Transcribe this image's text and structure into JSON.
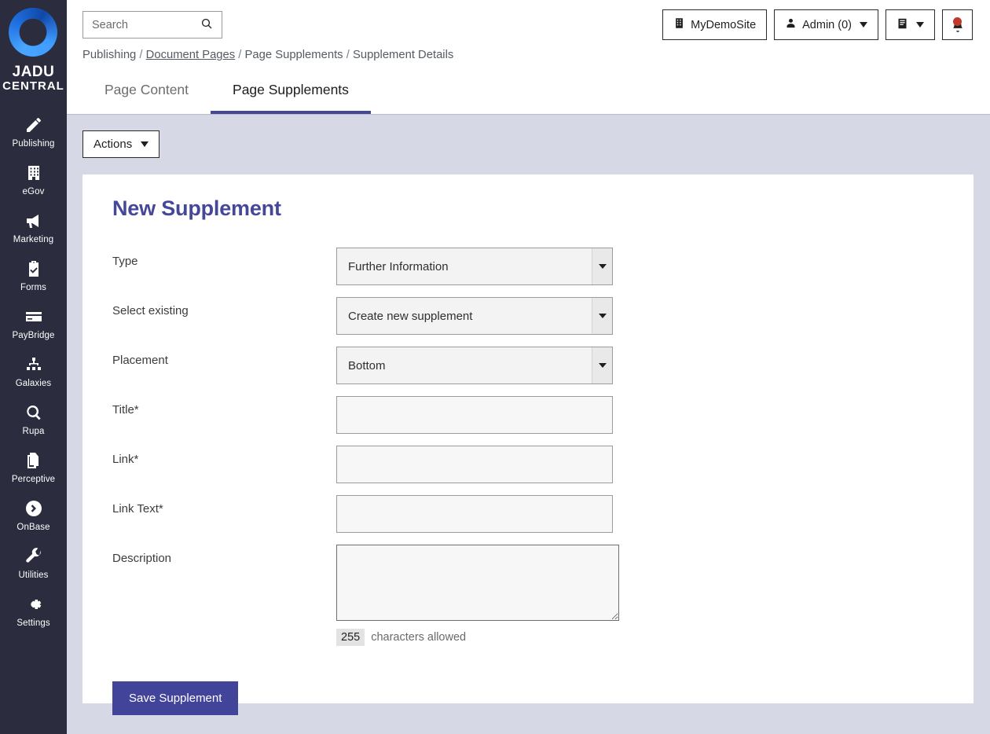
{
  "brand": {
    "logo_icon": "jadu-ring-logo",
    "line1": "JADU",
    "line2": "CENTRAL"
  },
  "sidebar": {
    "items": [
      {
        "label": "Publishing",
        "icon": "pencil-icon"
      },
      {
        "label": "eGov",
        "icon": "building-icon"
      },
      {
        "label": "Marketing",
        "icon": "megaphone-icon"
      },
      {
        "label": "Forms",
        "icon": "clipboard-check-icon"
      },
      {
        "label": "PayBridge",
        "icon": "credit-card-icon"
      },
      {
        "label": "Galaxies",
        "icon": "sitemap-icon"
      },
      {
        "label": "Rupa",
        "icon": "magnifier-icon"
      },
      {
        "label": "Perceptive",
        "icon": "copy-documents-icon"
      },
      {
        "label": "OnBase",
        "icon": "circle-chevron-right-icon"
      },
      {
        "label": "Utilities",
        "icon": "wrench-icon"
      },
      {
        "label": "Settings",
        "icon": "gear-icon"
      }
    ]
  },
  "header": {
    "search": {
      "value": "",
      "placeholder": "Search",
      "icon": "search-icon"
    },
    "site_button": {
      "label": "MyDemoSite",
      "icon": "building-icon"
    },
    "admin_button": {
      "label": "Admin (0)",
      "icon": "user-icon",
      "caret": "chevron-down-icon"
    },
    "docs_button": {
      "label": "",
      "icon": "book-icon",
      "caret": "chevron-down-icon"
    },
    "notifications_button": {
      "label": "",
      "icon": "bell-icon",
      "has_alert": true
    }
  },
  "breadcrumb": {
    "items": [
      "Publishing",
      "Document Pages",
      "Page Supplements",
      "Supplement Details"
    ],
    "linked_index": 1,
    "separator": "/"
  },
  "tabs": [
    {
      "label": "Page Content",
      "active": false
    },
    {
      "label": "Page Supplements",
      "active": true
    }
  ],
  "toolbar": {
    "actions_label": "Actions",
    "actions_caret": "chevron-down-icon"
  },
  "form": {
    "title": "New Supplement",
    "fields": [
      {
        "label": "Type",
        "type": "select",
        "value": "Further Information"
      },
      {
        "label": "Select existing",
        "type": "select",
        "value": "Create new supplement"
      },
      {
        "label": "Placement",
        "type": "select",
        "value": "Bottom"
      },
      {
        "label": "Title*",
        "type": "text",
        "value": "",
        "placeholder": ""
      },
      {
        "label": "Link*",
        "type": "text",
        "value": "",
        "placeholder": ""
      },
      {
        "label": "Link Text*",
        "type": "text",
        "value": "",
        "placeholder": ""
      },
      {
        "label": "Description",
        "type": "textarea",
        "value": "",
        "placeholder": ""
      }
    ],
    "char_limit": "255",
    "char_limit_text": "characters allowed",
    "save_label": "Save Supplement"
  },
  "colors": {
    "brand_indigo": "#454799",
    "save_button": "#42449a",
    "sidebar_bg": "#2b2d3f",
    "page_bg": "#d6d8e6",
    "alert_dot": "#c0392b"
  }
}
